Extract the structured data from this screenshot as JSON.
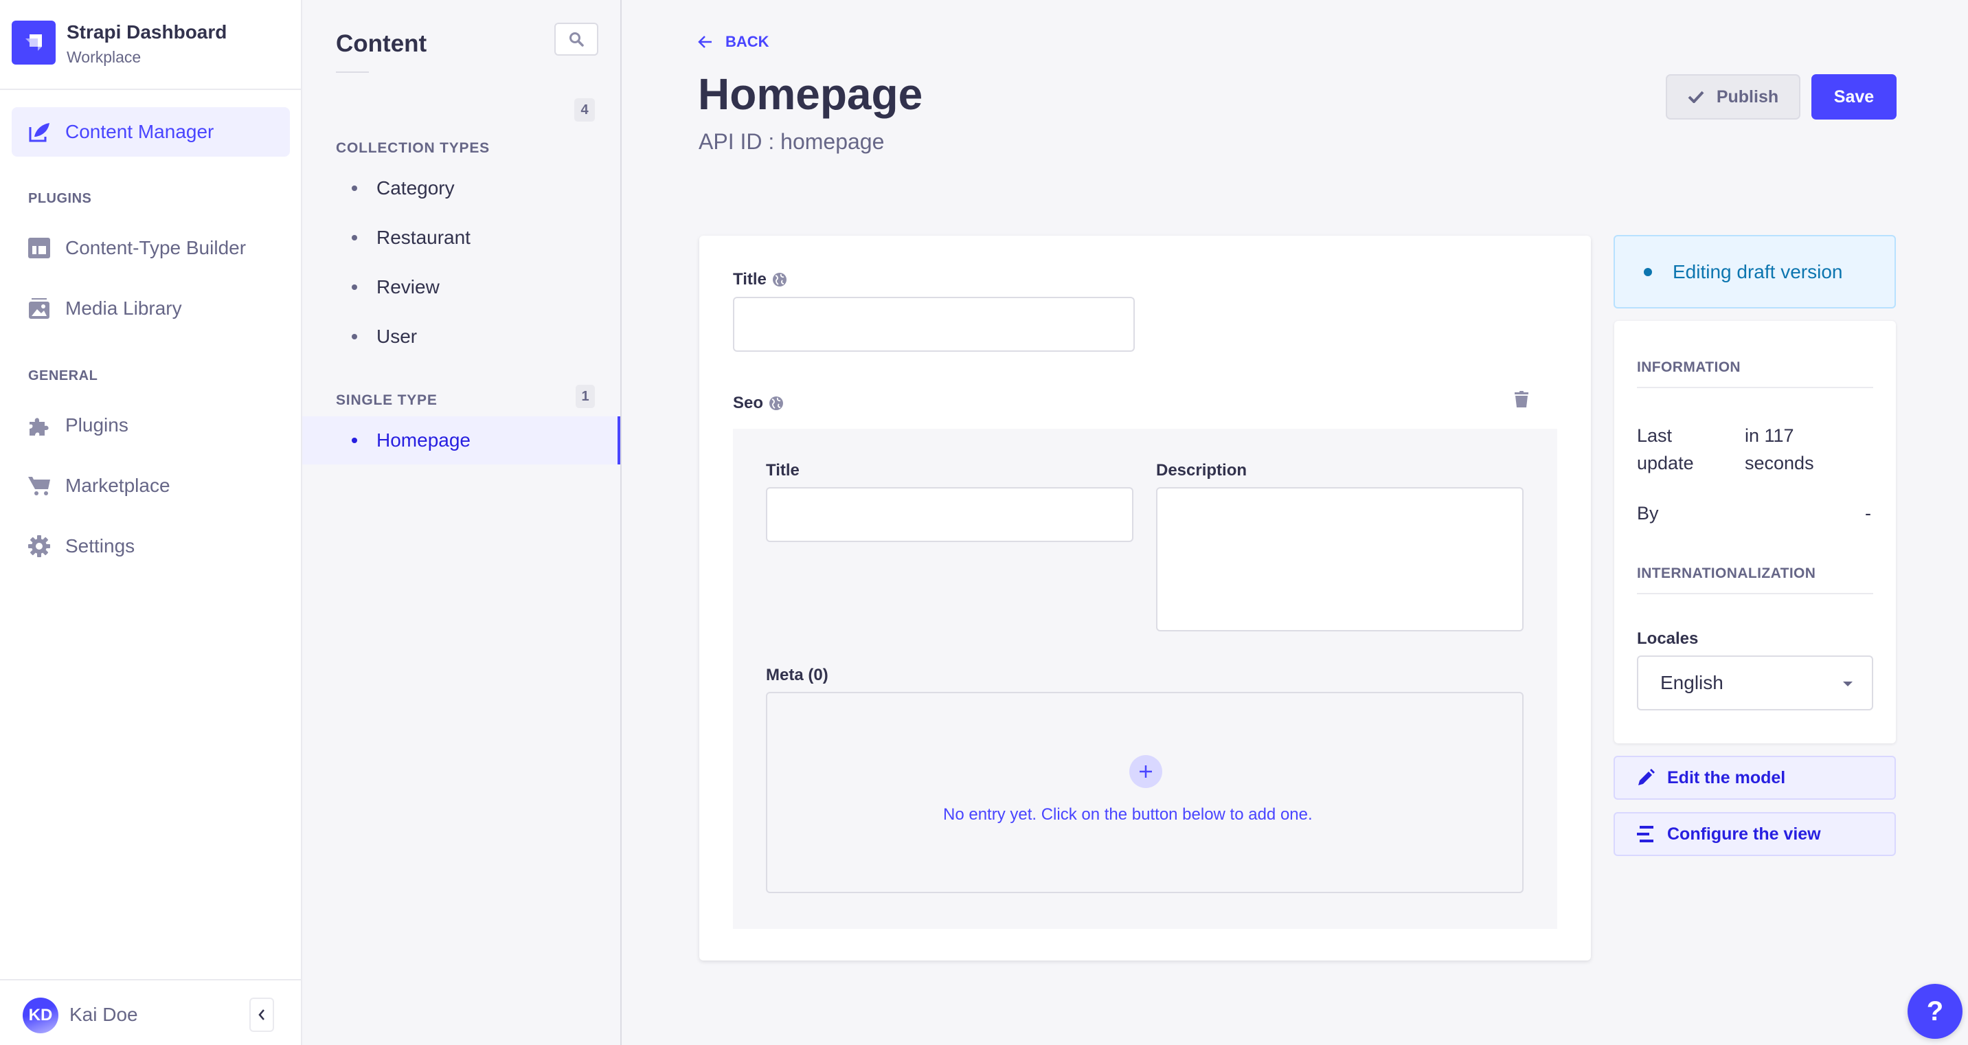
{
  "app": {
    "title": "Strapi Dashboard",
    "subtitle": "Workplace"
  },
  "nav": {
    "active": {
      "label": "Content Manager",
      "icon": "feather-icon"
    },
    "sections": [
      {
        "title": "PLUGINS",
        "items": [
          {
            "label": "Content-Type Builder",
            "icon": "layout-icon"
          },
          {
            "label": "Media Library",
            "icon": "image-icon"
          }
        ]
      },
      {
        "title": "GENERAL",
        "items": [
          {
            "label": "Plugins",
            "icon": "puzzle-icon"
          },
          {
            "label": "Marketplace",
            "icon": "cart-icon"
          },
          {
            "label": "Settings",
            "icon": "gear-icon"
          }
        ]
      }
    ],
    "user": {
      "initials": "KD",
      "name": "Kai Doe"
    }
  },
  "subnav": {
    "title": "Content",
    "collection": {
      "title": "COLLECTION TYPES",
      "count": "4",
      "items": [
        "Category",
        "Restaurant",
        "Review",
        "User"
      ]
    },
    "single": {
      "title": "SINGLE TYPE",
      "count": "1",
      "items": [
        "Homepage"
      ]
    }
  },
  "header": {
    "back": "BACK",
    "title": "Homepage",
    "api_id": "API ID : homepage",
    "publish": "Publish",
    "save": "Save"
  },
  "form": {
    "title_label": "Title",
    "title_value": "",
    "seo_label": "Seo",
    "seo": {
      "title_label": "Title",
      "title_value": "",
      "description_label": "Description",
      "description_value": "",
      "meta_label": "Meta (0)",
      "meta_empty": "No entry yet. Click on the button below to add one."
    }
  },
  "panel": {
    "status": "Editing draft version",
    "information": "INFORMATION",
    "last_update_label": "Last update",
    "last_update_value": "in 117 seconds",
    "by_label": "By",
    "by_value": "-",
    "i18n": "INTERNATIONALIZATION",
    "locales_label": "Locales",
    "locale_selected": "English",
    "edit_model": "Edit the model",
    "configure_view": "Configure the view"
  },
  "help": "?",
  "colors": {
    "primary": "#4945ff",
    "primary_dark": "#271fe0",
    "neutral_text": "#32324d",
    "muted_text": "#666687",
    "draft": "#0c75af"
  }
}
